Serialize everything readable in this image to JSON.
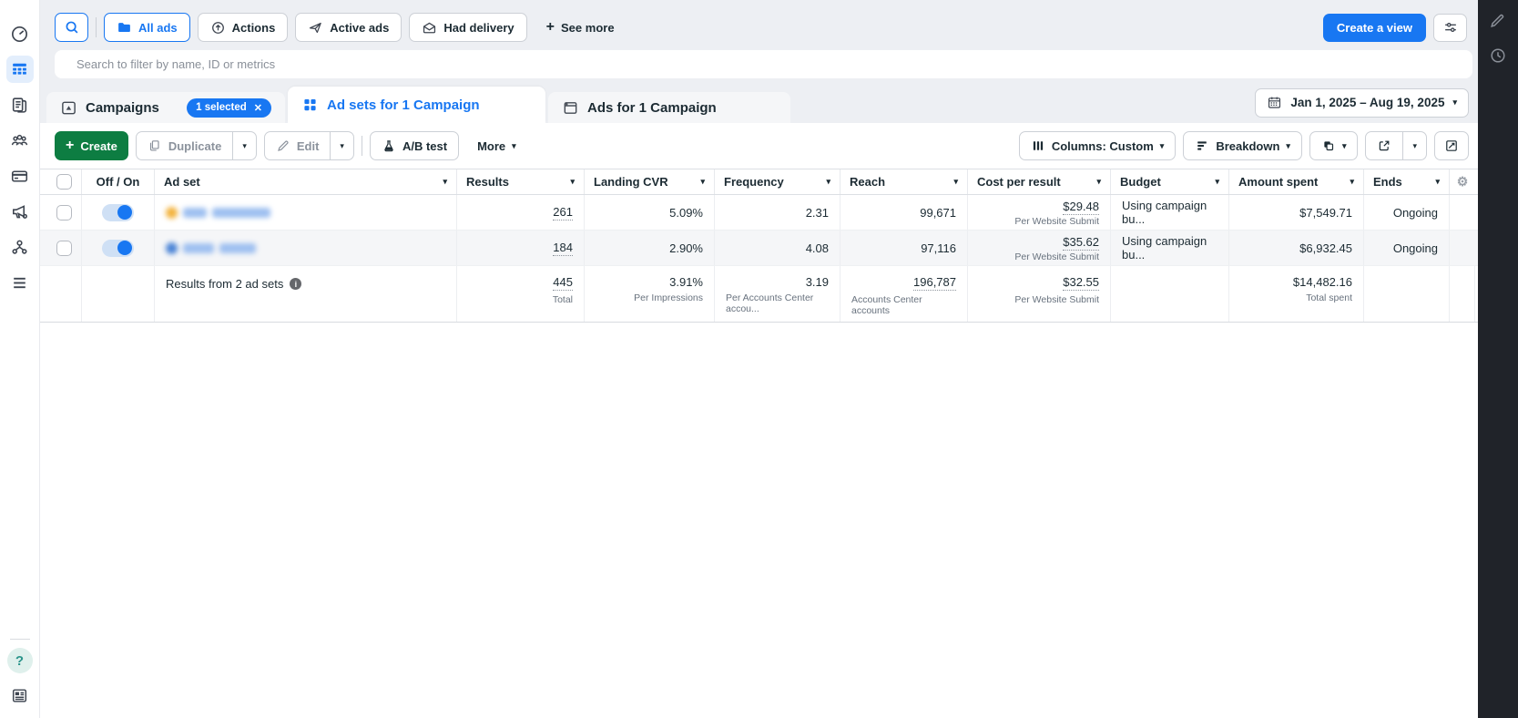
{
  "colors": {
    "accent_blue": "#1877f2",
    "create_green": "#0d7d42",
    "right_rail_bg": "#202329",
    "row_alt_bg": "#f5f6f8",
    "row1_dot": "#f3b33e",
    "row2_dot": "#4b84d6",
    "help_circle_bg": "#dff0ec"
  },
  "icons": {
    "caret_down": "▾",
    "close": "✕",
    "plus": "+",
    "help": "?",
    "info": "i",
    "gear": "⚙"
  },
  "filter_bar": {
    "all_ads": "All ads",
    "actions": "Actions",
    "active_ads": "Active ads",
    "had_delivery": "Had delivery",
    "see_more": "See more",
    "create_view": "Create a view"
  },
  "search": {
    "placeholder": "Search to filter by name, ID or metrics"
  },
  "tabs": {
    "campaigns": {
      "label": "Campaigns",
      "badge": "1 selected"
    },
    "adsets": {
      "label": "Ad sets for 1 Campaign"
    },
    "ads": {
      "label": "Ads for 1 Campaign"
    }
  },
  "date_range": {
    "label": "Jan 1, 2025 – Aug 19, 2025"
  },
  "toolbar": {
    "create": "Create",
    "duplicate": "Duplicate",
    "edit": "Edit",
    "ab_test": "A/B test",
    "more": "More",
    "columns": "Columns: Custom",
    "breakdown": "Breakdown"
  },
  "table": {
    "columns": {
      "off_on": "Off / On",
      "ad_set": "Ad set",
      "results": "Results",
      "landing_cvr": "Landing CVR",
      "frequency": "Frequency",
      "reach": "Reach",
      "cost_per_result": "Cost per result",
      "budget": "Budget",
      "amount_spent": "Amount spent",
      "ends": "Ends"
    },
    "rows": [
      {
        "toggle": "on",
        "name_redacted": true,
        "results": "261",
        "landing_cvr": "5.09%",
        "frequency": "2.31",
        "reach": "99,671",
        "cost_per_result": "$29.48",
        "cost_per_result_sub": "Per Website Submit",
        "budget": "Using campaign bu...",
        "amount_spent": "$7,549.71",
        "ends": "Ongoing"
      },
      {
        "toggle": "on",
        "name_redacted": true,
        "results": "184",
        "landing_cvr": "2.90%",
        "frequency": "4.08",
        "reach": "97,116",
        "cost_per_result": "$35.62",
        "cost_per_result_sub": "Per Website Submit",
        "budget": "Using campaign bu...",
        "amount_spent": "$6,932.45",
        "ends": "Ongoing"
      }
    ],
    "summary": {
      "label": "Results from 2 ad sets",
      "results": "445",
      "results_sub": "Total",
      "landing_cvr": "3.91%",
      "landing_cvr_sub": "Per Impressions",
      "frequency": "3.19",
      "frequency_sub": "Per Accounts Center accou...",
      "reach": "196,787",
      "reach_sub": "Accounts Center accounts",
      "cost_per_result": "$32.55",
      "cost_per_result_sub": "Per Website Submit",
      "amount_spent": "$14,482.16",
      "amount_spent_sub": "Total spent"
    }
  }
}
